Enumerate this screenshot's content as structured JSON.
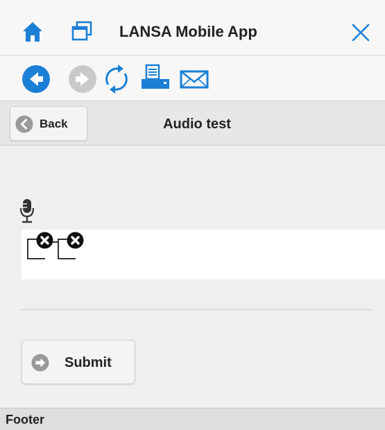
{
  "app": {
    "title": "LANSA Mobile App"
  },
  "titlebar": {
    "icons": [
      "home-icon",
      "windows-icon",
      "close-icon"
    ]
  },
  "toolbar": {
    "icons": [
      "back-circle-icon",
      "forward-circle-icon",
      "refresh-icon",
      "print-icon",
      "mail-icon"
    ]
  },
  "page": {
    "back_label": "Back",
    "title": "Audio test"
  },
  "audio": {
    "icons": [
      "microphone-icon",
      "broken-image-icon",
      "broken-image-icon"
    ]
  },
  "actions": {
    "submit_label": "Submit"
  },
  "footer": {
    "label": "Footer"
  },
  "colors": {
    "accent": "#1b7fd6",
    "disabled": "#c9c9c9",
    "button_bg": "#f4f4f4",
    "icon_gray": "#9a9a9a"
  }
}
